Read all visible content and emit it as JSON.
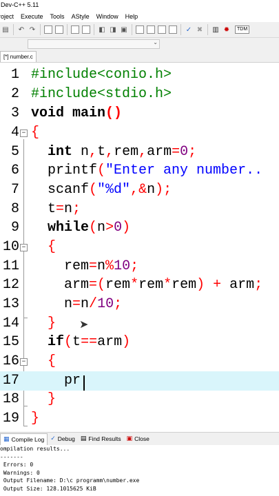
{
  "window": {
    "title": "Dev-C++ 5.11"
  },
  "menu": [
    "roject",
    "Execute",
    "Tools",
    "AStyle",
    "Window",
    "Help"
  ],
  "toolbar": {
    "tdm_label": "TDM"
  },
  "file_tab": "[*] number.c",
  "code_lines": [
    {
      "n": "1",
      "text": "#include<conio.h>"
    },
    {
      "n": "2",
      "text": "#include<stdio.h>"
    },
    {
      "n": "3",
      "text": "void main()"
    },
    {
      "n": "4",
      "text": "{"
    },
    {
      "n": "5",
      "text": "  int n,t,rem,arm=0;"
    },
    {
      "n": "6",
      "text": "  printf(\"Enter any number.."
    },
    {
      "n": "7",
      "text": "  scanf(\"%d\",&n);"
    },
    {
      "n": "8",
      "text": "  t=n;"
    },
    {
      "n": "9",
      "text": "  while(n>0)"
    },
    {
      "n": "10",
      "text": "  {"
    },
    {
      "n": "11",
      "text": "    rem=n%10;"
    },
    {
      "n": "12",
      "text": "    arm=(rem*rem*rem) + arm;"
    },
    {
      "n": "13",
      "text": "    n=n/10;"
    },
    {
      "n": "14",
      "text": "  }"
    },
    {
      "n": "15",
      "text": "  if(t==arm)"
    },
    {
      "n": "16",
      "text": "  {"
    },
    {
      "n": "17",
      "text": "    pr"
    },
    {
      "n": "18",
      "text": "  }"
    },
    {
      "n": "19",
      "text": "}"
    }
  ],
  "bottom_tabs": {
    "compile_log": "Compile Log",
    "debug": "Debug",
    "find_results": "Find Results",
    "close": "Close"
  },
  "log": [
    "ompilation results...",
    "-------",
    " Errors: 0",
    " Warnings: 0",
    " Output Filename: D:\\c programm\\number.exe",
    " Output Size: 128.1015625 KiB"
  ],
  "colors": {
    "keyword": "#000000",
    "preprocessor": "#008000",
    "string": "#0000ff",
    "number": "#800080",
    "symbol": "#ff0000",
    "current_line": "#d9f5fb"
  }
}
